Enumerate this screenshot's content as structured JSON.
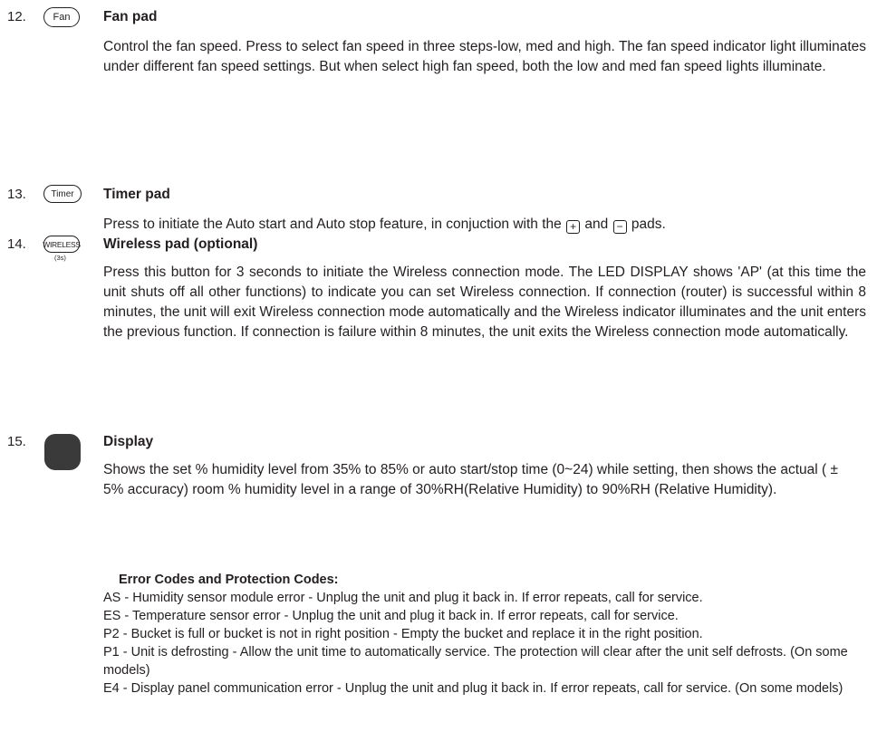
{
  "items": [
    {
      "number": "12.",
      "icon_label": "Fan",
      "title": "Fan pad",
      "text": "Control the fan speed. Press to select fan speed in three steps-low, med and high. The fan speed indicator light illuminates under different fan speed settings. But when select high fan speed, both the low and med fan speed lights illuminate."
    },
    {
      "number": "13.",
      "icon_label": "Timer",
      "title": "Timer pad",
      "text_before": "Press to initiate the Auto start and Auto stop feature, in conjuction with the",
      "plus_symbol": "+",
      "text_middle": "and",
      "minus_symbol": "−",
      "text_after": "pads."
    },
    {
      "number": "14.",
      "icon_label": "WIRELESS",
      "icon_sublabel": "(3s)",
      "title": "Wireless pad (optional)",
      "text": "Press this button for 3 seconds to initiate the Wireless connection mode. The LED DISPLAY shows 'AP' (at this time the unit shuts off all other functions) to indicate you can set Wireless connection. If connection (router) is successful within 8 minutes, the unit will exit Wireless connection mode automatically and the Wireless indicator illuminates and the unit enters the previous function. If connection is failure within 8 minutes, the unit exits the Wireless connection mode automatically."
    },
    {
      "number": "15.",
      "title": "Display",
      "text": "Shows the set % humidity level from 35% to 85% or auto start/stop time (0~24) while setting, then shows the actual ( ± 5% accuracy) room % humidity level in a range of 30%RH(Relative Humidity) to 90%RH (Relative Humidity).",
      "errors_title": "Error Codes and Protection Codes:",
      "errors": [
        "AS - Humidity sensor module error - Unplug the unit and plug it back in. If error repeats, call for service.",
        "ES - Temperature sensor error -  Unplug the unit and plug it back in. If error repeats, call for service.",
        "P2 - Bucket is full or bucket is not in right position -  Empty the bucket and replace it in the right position.",
        "P1 - Unit is defrosting - Allow the unit time to automatically service. The protection will clear after the unit self defrosts. (On some models)",
        "E4 - Display panel communication error - Unplug the unit and plug it back in. If error repeats, call for service. (On some models)"
      ]
    }
  ]
}
